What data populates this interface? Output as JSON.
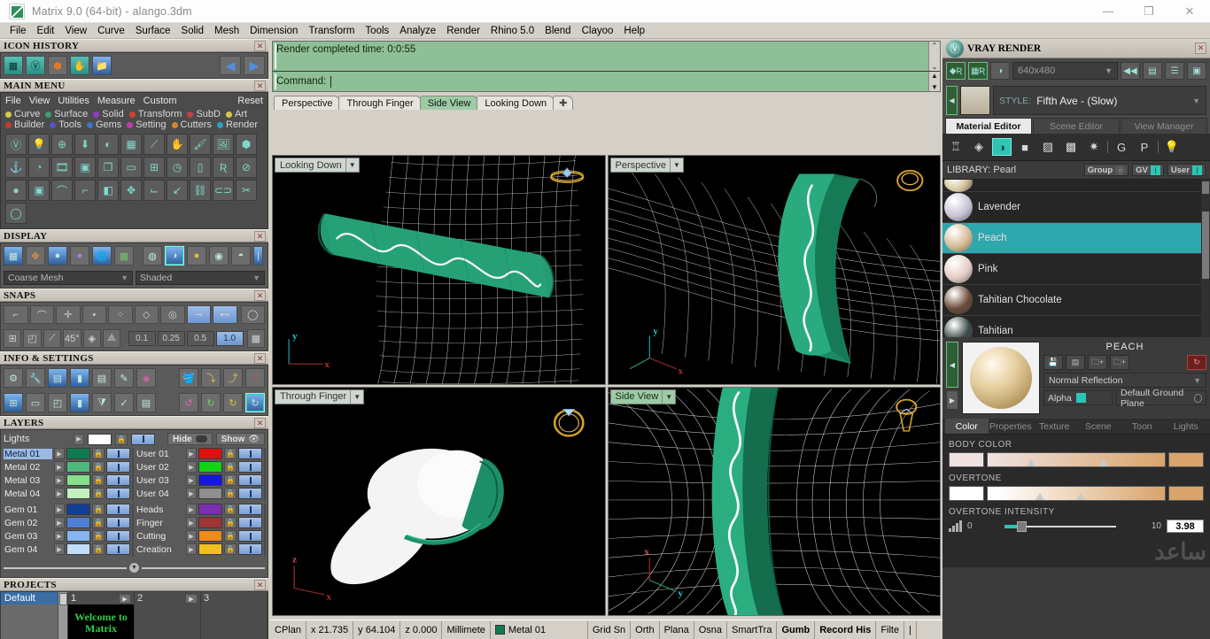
{
  "window": {
    "title": "Matrix 9.0 (64-bit) - alango.3dm",
    "app_icon": "matrix-logo-icon",
    "minimize": "—",
    "maximize": "❐",
    "close": "✕"
  },
  "menubar": [
    "File",
    "Edit",
    "View",
    "Curve",
    "Surface",
    "Solid",
    "Mesh",
    "Dimension",
    "Transform",
    "Tools",
    "Analyze",
    "Render",
    "Rhino 5.0",
    "Blend",
    "Clayoo",
    "Help"
  ],
  "panels": {
    "icon_history": {
      "title": "ICON HISTORY",
      "close": "✕",
      "icons": [
        "grid-icon",
        "vray-icon",
        "gem-orange-icon",
        "hand-icon",
        "folder-icon"
      ],
      "back": "◀",
      "forward": "▶"
    },
    "main_menu": {
      "title": "MAIN MENU",
      "close": "✕",
      "row1": [
        "File",
        "View",
        "Utilities",
        "Measure",
        "Custom"
      ],
      "reset": "Reset",
      "categories": [
        {
          "label": "Curve",
          "color": "#d4c84a"
        },
        {
          "label": "Surface",
          "color": "#3e9e6e"
        },
        {
          "label": "Solid",
          "color": "#8e3ec4"
        },
        {
          "label": "Transform",
          "color": "#d0432e"
        },
        {
          "label": "SubD",
          "color": "#c44040"
        },
        {
          "label": "Art",
          "color": "#d4c84a"
        },
        {
          "label": "Builder",
          "color": "#c43b2e"
        },
        {
          "label": "Tools",
          "color": "#5a54c4"
        },
        {
          "label": "Gems",
          "color": "#3d74c4"
        },
        {
          "label": "Setting",
          "color": "#c43ab0"
        },
        {
          "label": "Cutters",
          "color": "#d4882e"
        },
        {
          "label": "Render",
          "color": "#2e9ec4"
        }
      ],
      "tool_icons": [
        "vray-render-icon",
        "light-icon",
        "target-icon",
        "extrude-down-icon",
        "shade-icon",
        "chip-icon",
        "measure-icon",
        "hand-ring-icon",
        "paint-ring-icon",
        "image-icon",
        "gem-solid-icon",
        "anchor-icon",
        "ring-drop-icon",
        "film-ring-icon",
        "ring-frame-icon",
        "copy-ring-icon",
        "logo-icon",
        "quad-ring-icon",
        "gem-clock-icon",
        "band-icon",
        "r-disk-icon",
        "no-sign-icon",
        "sphere-icon",
        "cubes-icon",
        "curve-icon",
        "curve-dash-icon",
        "mirror-icon",
        "move-icon",
        "orient-icon",
        "arrow-down-icon",
        "link-icon",
        "cs-icon",
        "scissors-icon",
        "torus-icon"
      ]
    },
    "display": {
      "title": "DISPLAY",
      "close": "✕",
      "icons": [
        "wireframe-grid-icon",
        "ghost-icon",
        "shaded-ball-icon",
        "rendered-ball-icon",
        "globe-icon",
        "quad-green-icon"
      ],
      "icons2": [
        "xray-ball-icon",
        "shade-ball-icon",
        "gold-ball-icon",
        "tech-ball-icon",
        "grey-ball-icon"
      ],
      "mesh_combo": "Coarse Mesh",
      "shade_combo": "Shaded"
    },
    "snaps": {
      "title": "SNAPS",
      "close": "✕",
      "row1": [
        "end-snap-icon",
        "near-snap-icon",
        "point-snap-icon",
        "mid-snap-icon",
        "cen-snap-icon",
        "quad-snap-icon",
        "int-snap-icon",
        "perp-snap-icon",
        "tan-snap-icon",
        "circle-snap-icon"
      ],
      "row2": [
        "grid-snap-icon",
        "cube-snap-icon",
        "smart-line-icon",
        "angle-45-icon",
        "planar-icon",
        "osnap-icon"
      ],
      "values": [
        "0.1",
        "0.25",
        "0.5",
        "1.0"
      ],
      "selected_value": "1.0",
      "grid_btn": "grid-toggle-icon"
    },
    "info_settings": {
      "title": "INFO & SETTINGS",
      "close": "✕",
      "row1": [
        "gears-icon",
        "wrench-icon",
        "layers-icon",
        "book-blue-icon",
        "document-icon",
        "edit-doc-icon",
        "gem-pink-icon"
      ],
      "row1b": [
        "paint-bucket-icon",
        "import-yellow-icon",
        "export-yellow-icon",
        "delete-red-icon"
      ],
      "row2": [
        "grid-panel-icon",
        "monitor-icon",
        "box-nodes-icon",
        "book-icon",
        "filter-icon",
        "check-select-icon",
        "card-icon"
      ],
      "row2b": [
        "undo-pink-icon",
        "redo-green-icon",
        "redo-yellow-icon",
        "history-blue-icon"
      ]
    },
    "layers": {
      "title": "LAYERS",
      "close": "✕",
      "lights_label": "Lights",
      "lights_color": "#ffffff",
      "hide_label": "Hide",
      "show_label": "Show",
      "left_groups": [
        [
          {
            "name": "Metal 01",
            "color": "#0f7a52",
            "selected": true
          },
          {
            "name": "Metal 02",
            "color": "#4cbb7a"
          },
          {
            "name": "Metal 03",
            "color": "#86e08a"
          },
          {
            "name": "Metal 04",
            "color": "#c2f0bf"
          }
        ],
        [
          {
            "name": "Gem 01",
            "color": "#123f94"
          },
          {
            "name": "Gem 02",
            "color": "#4d7fd4"
          },
          {
            "name": "Gem 03",
            "color": "#86b6f0"
          },
          {
            "name": "Gem 04",
            "color": "#c3dcfa"
          }
        ]
      ],
      "right_groups": [
        [
          {
            "name": "User 01",
            "color": "#e01010"
          },
          {
            "name": "User 02",
            "color": "#12d412"
          },
          {
            "name": "User 03",
            "color": "#1418d8"
          },
          {
            "name": "User 04",
            "color": "#8e8e8e"
          }
        ],
        [
          {
            "name": "Heads",
            "color": "#7a2fb0"
          },
          {
            "name": "Finger",
            "color": "#9e3434"
          },
          {
            "name": "Cutting",
            "color": "#f08a18"
          },
          {
            "name": "Creation",
            "color": "#f0c020"
          }
        ]
      ]
    },
    "projects": {
      "title": "PROJECTS",
      "close": "✕",
      "selected": "Default",
      "cells": [
        {
          "number": "1",
          "thumb_line1": "Welcome to",
          "thumb_line2": "Matrix",
          "play": "▶"
        },
        {
          "number": "2",
          "play": "▶"
        },
        {
          "number": "3"
        }
      ]
    }
  },
  "command": {
    "history": "Render completed time: 0:0:55",
    "prompt": "Command:",
    "value": ""
  },
  "viewport_tabs": [
    {
      "label": "Perspective",
      "active": false
    },
    {
      "label": "Through Finger",
      "active": false
    },
    {
      "label": "Side View",
      "active": true
    },
    {
      "label": "Looking Down",
      "active": false
    },
    {
      "label": "✚",
      "active": false
    }
  ],
  "viewports": [
    {
      "label": "Looking Down",
      "active": false,
      "axis": {
        "x": "x",
        "y": "y"
      }
    },
    {
      "label": "Perspective",
      "active": false,
      "axis": {
        "x": "x",
        "y": "y"
      }
    },
    {
      "label": "Through Finger",
      "active": false,
      "axis": {
        "x": "x",
        "z": "z"
      }
    },
    {
      "label": "Side View",
      "active": true,
      "axis": {
        "x": "x",
        "y": "y"
      }
    }
  ],
  "statusbar": {
    "cplane": "CPlan",
    "x": "x 21.735",
    "y": "y 64.104",
    "z": "z 0.000",
    "units": "Millimete",
    "layer": "Metal 01",
    "layer_color": "#0f7a52",
    "toggles": [
      "Grid Sn",
      "Orth",
      "Plana",
      "Osna",
      "SmartTra"
    ],
    "bold_toggles": [
      "Gumb",
      "Record His"
    ],
    "filter": "Filte"
  },
  "vray": {
    "title": "VRAY RENDER",
    "close": "✕",
    "toolbar_icons": [
      "render-material-icon",
      "render-region-icon",
      "render-ball-icon"
    ],
    "resolution": "640x480",
    "right_icons": [
      "rewind-icon",
      "render-settings-icon",
      "list-icon",
      "frame-buffer-icon"
    ],
    "style_key": "STYLE:",
    "style_value": "Fifth Ave - (Slow)",
    "tabs": [
      {
        "label": "Material Editor",
        "active": true
      },
      {
        "label": "Scene Editor",
        "active": false
      },
      {
        "label": "View Manager",
        "active": false
      }
    ],
    "material_toolbar": [
      "metal-drop-icon",
      "gem-icon",
      "pearl-ball-icon",
      "plain-square-icon",
      "pattern-icon",
      "texture-icon",
      "bump-icon",
      "goggles-g-icon",
      "goggles-p-icon",
      "bulb-icon"
    ],
    "selected_material_tool": "pearl-ball-icon",
    "library": {
      "label": "LIBRARY: Pearl",
      "group_label": "Group",
      "gv_label": "GV",
      "user_label": "User",
      "items": [
        {
          "name": "",
          "color": "#d3c39a",
          "partial": true
        },
        {
          "name": "Lavender",
          "color": "#c9c3d6"
        },
        {
          "name": "Peach",
          "color": "#d5bb94",
          "selected": true
        },
        {
          "name": "Pink",
          "color": "#e5cdc6"
        },
        {
          "name": "Tahitian Chocolate",
          "color": "#6b4b38"
        },
        {
          "name": "Tahitian",
          "color": "#3a4a48"
        }
      ]
    },
    "preview": {
      "name": "PEACH",
      "icons": [
        "save-icon",
        "save-as-icon",
        "add-folder-icon",
        "add-folder2-icon",
        "refresh-icon"
      ],
      "reflection": "Normal Reflection",
      "alpha_label": "Alpha",
      "ground_plane": "Default Ground Plane",
      "tabs": [
        {
          "label": "Color",
          "active": true
        },
        {
          "label": "Properties",
          "active": false
        },
        {
          "label": "Texture",
          "active": false
        },
        {
          "label": "Scene",
          "active": false
        },
        {
          "label": "Toon",
          "active": false
        },
        {
          "label": "Lights",
          "active": false
        }
      ],
      "body_color_label": "BODY COLOR",
      "body_color_start": "#efe2e0",
      "body_color_end": "#d9a46b",
      "overtone_label": "OVERTONE",
      "overtone_start": "#ffffff",
      "overtone_end": "#d9a46b",
      "overtone_intensity_label": "OVERTONE INTENSITY",
      "intensity_min": "0",
      "intensity_max": "10",
      "intensity_value": "3.98"
    }
  }
}
